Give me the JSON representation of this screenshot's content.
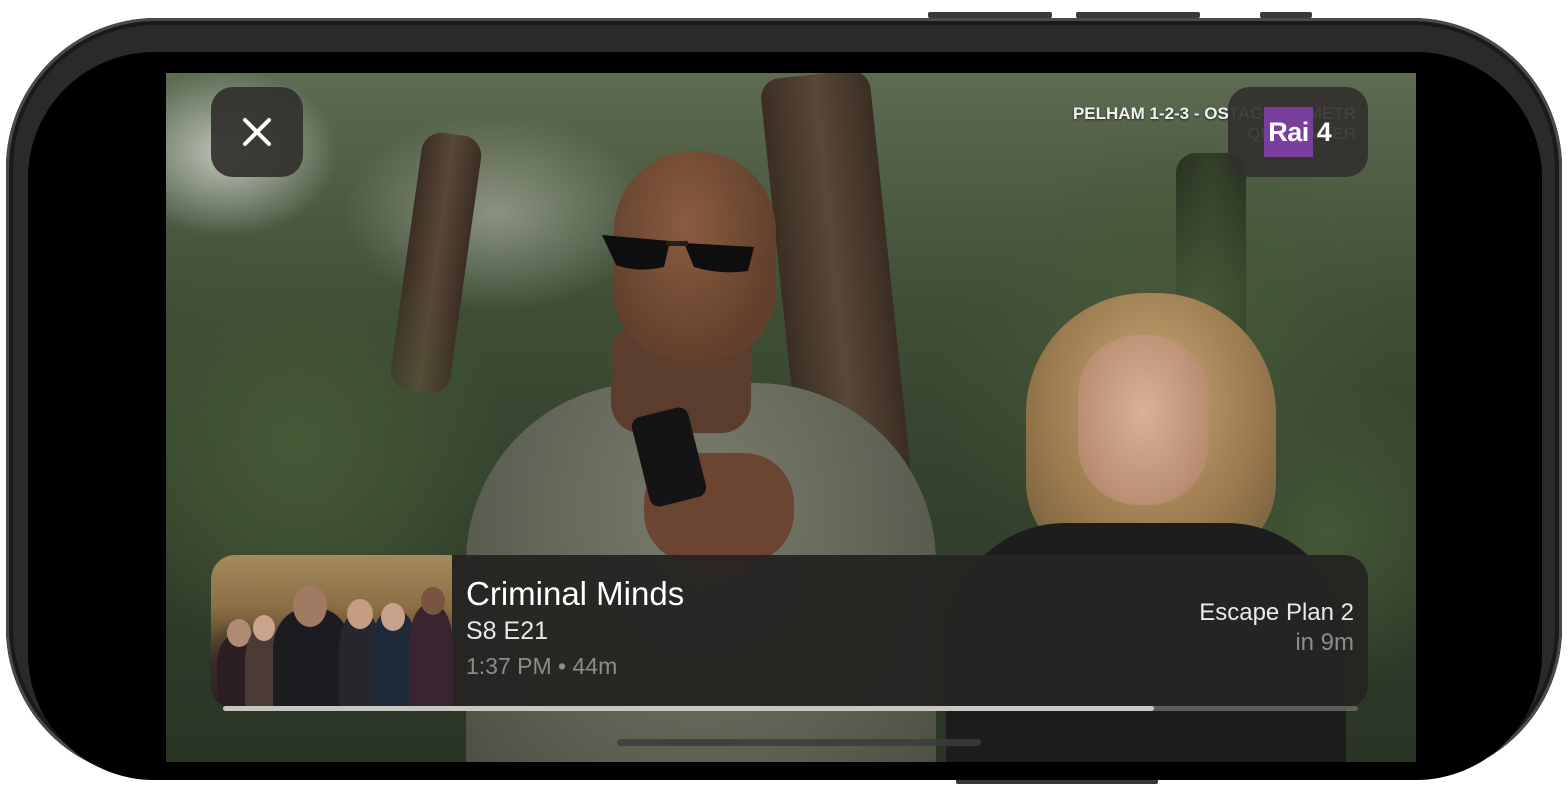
{
  "channel": {
    "logo_text": "Rai",
    "logo_number": "4",
    "logo_color": "#7a3f9d"
  },
  "video_overlay": {
    "line1": "PELHAM 1-2-3 - OSTAGGI IN METR",
    "line2": "QUESTA SER"
  },
  "now_playing": {
    "title": "Criminal Minds",
    "episode": "S8 E21",
    "start_time": "1:37 PM",
    "separator": "•",
    "duration": "44m",
    "progress_fraction": 0.82
  },
  "up_next": {
    "title": "Escape Plan 2",
    "starts_in": "in 9m"
  },
  "icons": {
    "close": "close-icon",
    "channel": "rai4-logo"
  }
}
